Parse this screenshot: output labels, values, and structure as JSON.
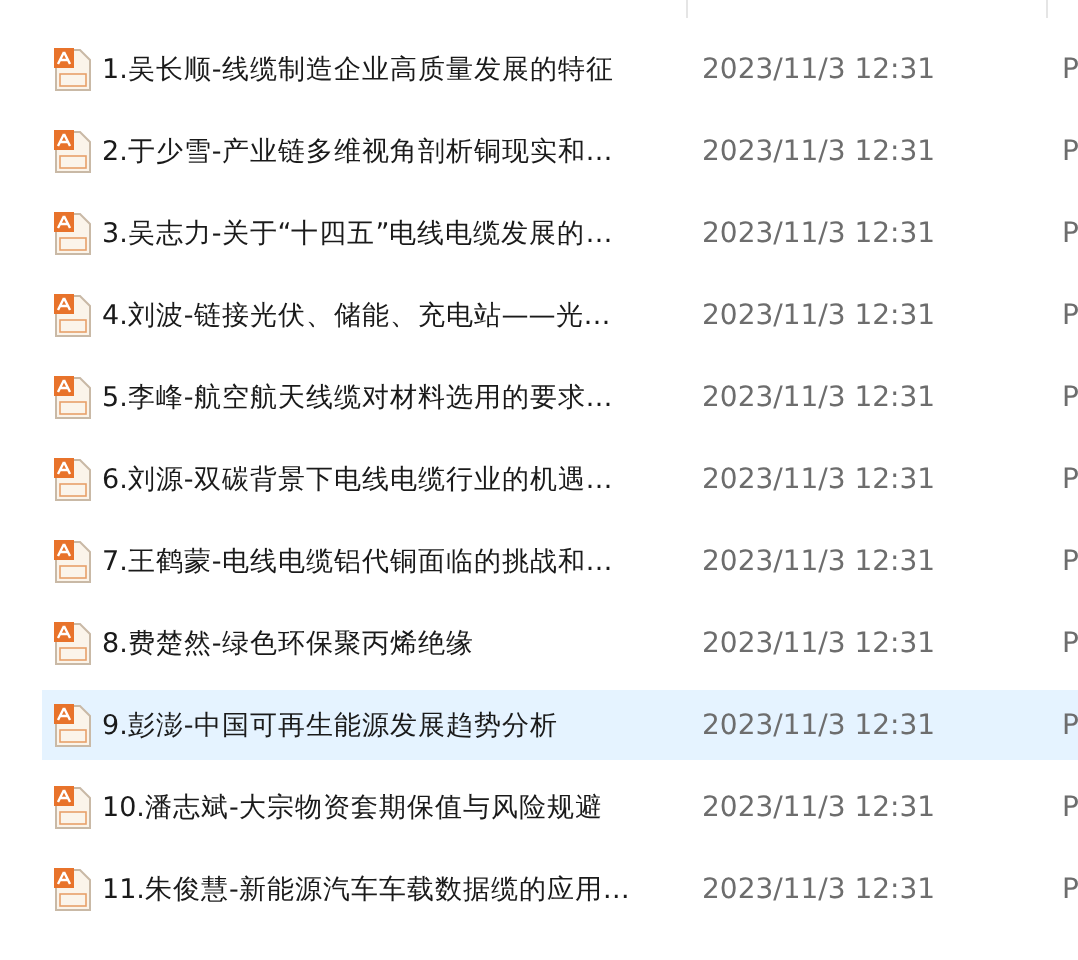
{
  "files": [
    {
      "name": "1.吴长顺-线缆制造企业高质量发展的特征",
      "modified": "2023/11/3 12:31",
      "type": "P",
      "selected": false
    },
    {
      "name": "2.于少雪-产业链多维视角剖析铜现实和…",
      "modified": "2023/11/3 12:31",
      "type": "P",
      "selected": false
    },
    {
      "name": "3.吴志力-关于“十四五”电线电缆发展的…",
      "modified": "2023/11/3 12:31",
      "type": "P",
      "selected": false
    },
    {
      "name": "4.刘波-链接光伏、储能、充电站——光…",
      "modified": "2023/11/3 12:31",
      "type": "P",
      "selected": false
    },
    {
      "name": "5.李峰-航空航天线缆对材料选用的要求…",
      "modified": "2023/11/3 12:31",
      "type": "P",
      "selected": false
    },
    {
      "name": "6.刘源-双碳背景下电线电缆行业的机遇…",
      "modified": "2023/11/3 12:31",
      "type": "P",
      "selected": false
    },
    {
      "name": "7.王鹤蒙-电线电缆铝代铜面临的挑战和…",
      "modified": "2023/11/3 12:31",
      "type": "P",
      "selected": false
    },
    {
      "name": "8.费楚然-绿色环保聚丙烯绝缘",
      "modified": "2023/11/3 12:31",
      "type": "P",
      "selected": false
    },
    {
      "name": "9.彭澎-中国可再生能源发展趋势分析",
      "modified": "2023/11/3 12:31",
      "type": "P",
      "selected": true
    },
    {
      "name": "10.潘志斌-大宗物资套期保值与风险规避",
      "modified": "2023/11/3 12:31",
      "type": "P",
      "selected": false
    },
    {
      "name": "11.朱俊慧-新能源汽车车载数据缆的应用…",
      "modified": "2023/11/3 12:31",
      "type": "P",
      "selected": false
    }
  ]
}
